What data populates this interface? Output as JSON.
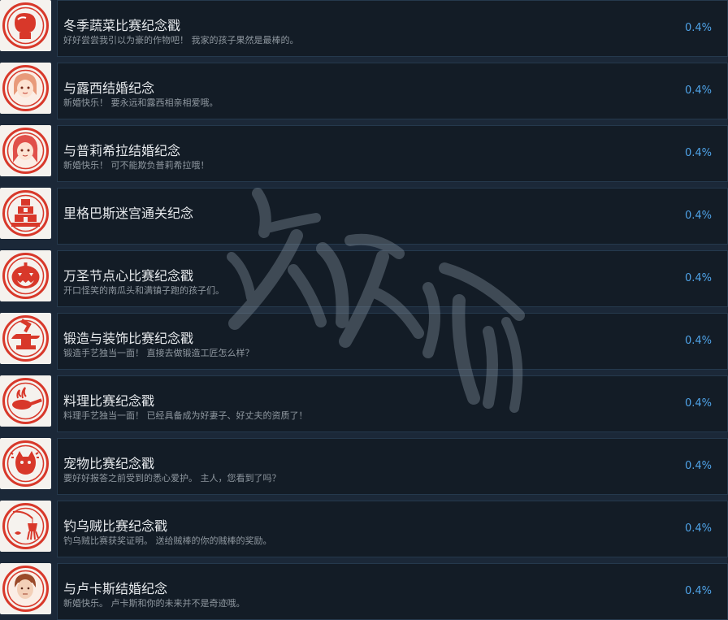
{
  "achievements": [
    {
      "icon": "boxing-glove-icon",
      "title": "冬季蔬菜比赛纪念戳",
      "desc": "好好尝尝我引以为豪的作物吧！ 我家的孩子果然是最棒的。",
      "percent": "0.4%"
    },
    {
      "icon": "girl-portrait-icon",
      "title": "与露西结婚纪念",
      "desc": "新婚快乐！ 要永远和露西相亲相爱哦。",
      "percent": "0.4%"
    },
    {
      "icon": "girl-portrait-icon",
      "title": "与普莉希拉结婚纪念",
      "desc": "新婚快乐！ 可不能欺负普莉希拉哦！",
      "percent": "0.4%"
    },
    {
      "icon": "castle-tower-icon",
      "title": "里格巴斯迷宫通关纪念",
      "desc": "",
      "percent": "0.4%"
    },
    {
      "icon": "jack-o-lantern-icon",
      "title": "万圣节点心比赛纪念戳",
      "desc": "开口怪笑的南瓜头和满镇子跑的孩子们。",
      "percent": "0.4%"
    },
    {
      "icon": "anvil-hammer-icon",
      "title": "锻造与装饰比赛纪念戳",
      "desc": "锻造手艺独当一面！ 直接去做锻造工匠怎么样？",
      "percent": "0.4%"
    },
    {
      "icon": "frying-pan-icon",
      "title": "料理比赛纪念戳",
      "desc": "料理手艺独当一面！ 已经具备成为好妻子、好丈夫的资质了！",
      "percent": "0.4%"
    },
    {
      "icon": "pet-creature-icon",
      "title": "宠物比赛纪念戳",
      "desc": "要好好报答之前受到的悉心爱护。 主人，您看到了吗？",
      "percent": "0.4%"
    },
    {
      "icon": "fishing-squid-icon",
      "title": "钓乌贼比赛纪念戳",
      "desc": "钓乌贼比赛获奖证明。 送给贼棒的你的贼棒的奖励。",
      "percent": "0.4%"
    },
    {
      "icon": "man-portrait-icon",
      "title": "与卢卡斯结婚纪念",
      "desc": "新婚快乐。 卢卡斯和你的未来并不是奇迹哦。",
      "percent": "0.4%"
    }
  ],
  "colors": {
    "background": "#1b2838",
    "panel": "#131c26",
    "border": "#25394d",
    "percent": "#4fa3e8",
    "stamp_red": "#d8382a"
  }
}
